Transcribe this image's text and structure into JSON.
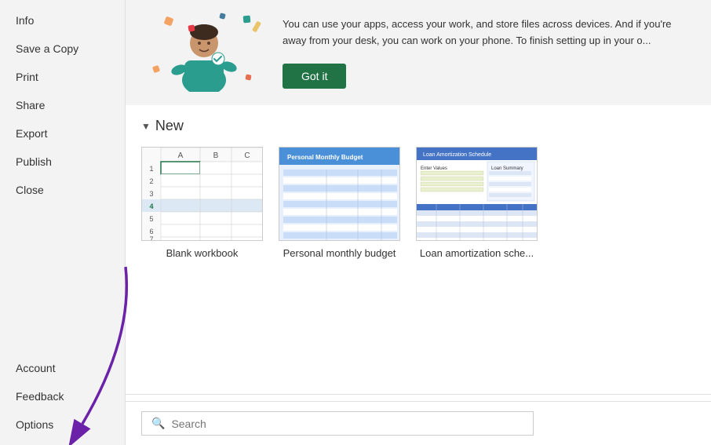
{
  "sidebar": {
    "top_items": [
      {
        "id": "info",
        "label": "Info"
      },
      {
        "id": "save-copy",
        "label": "Save a Copy"
      },
      {
        "id": "print",
        "label": "Print"
      },
      {
        "id": "share",
        "label": "Share"
      },
      {
        "id": "export",
        "label": "Export"
      },
      {
        "id": "publish",
        "label": "Publish"
      },
      {
        "id": "close",
        "label": "Close"
      }
    ],
    "bottom_items": [
      {
        "id": "account",
        "label": "Account"
      },
      {
        "id": "feedback",
        "label": "Feedback"
      },
      {
        "id": "options",
        "label": "Options"
      }
    ]
  },
  "banner": {
    "text": "You can use your apps, access your work, and store files across devices. And if you're away from your desk, you can work on your phone. To finish setting up in your o...",
    "got_it_label": "Got it"
  },
  "new_section": {
    "title": "New",
    "templates": [
      {
        "id": "blank-workbook",
        "label": "Blank workbook"
      },
      {
        "id": "personal-monthly-budget",
        "label": "Personal monthly budget"
      },
      {
        "id": "loan-amortization",
        "label": "Loan amortization sche..."
      }
    ]
  },
  "search": {
    "placeholder": "Search",
    "icon": "search"
  },
  "arrow": {
    "visible": true
  }
}
